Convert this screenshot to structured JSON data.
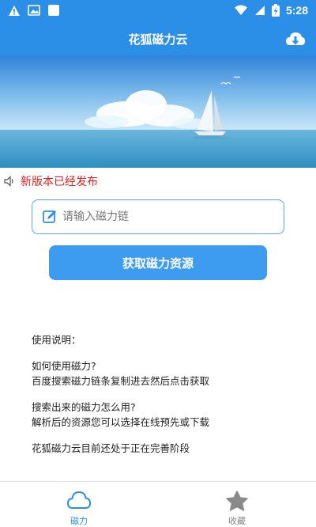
{
  "status_bar": {
    "time": "5:28",
    "icons": [
      "warning-icon",
      "image-icon",
      "app-icon",
      "wifi-icon",
      "signal-icon",
      "battery-charging-icon"
    ]
  },
  "header": {
    "title": "花狐磁力云",
    "download_icon": "download-icon"
  },
  "banner": {
    "image": "sea-sailboat-banner"
  },
  "notice": {
    "icon": "speaker-icon",
    "text": "新版本已经发布"
  },
  "search": {
    "placeholder": "请输入磁力链",
    "value": "",
    "icon": "edit-icon"
  },
  "fetch_button": {
    "label": "获取磁力资源"
  },
  "instructions": {
    "heading": "使用说明：",
    "q1": "如何使用磁力?",
    "a1": "百度搜索磁力链条复制进去然后点击获取",
    "q2": "搜索出来的磁力怎么用?",
    "a2": "解析后的资源您可以选择在线预先或下载",
    "note": "花狐磁力云目前还处于正在完善阶段"
  },
  "bottom_nav": {
    "items": [
      {
        "label": "磁力",
        "icon": "cloud-icon",
        "active": true
      },
      {
        "label": "收藏",
        "icon": "star-icon",
        "active": false
      }
    ]
  },
  "colors": {
    "primary": "#2b8fe8",
    "button": "#3d9cf0",
    "notice": "#e02020",
    "inactive": "#888888"
  }
}
